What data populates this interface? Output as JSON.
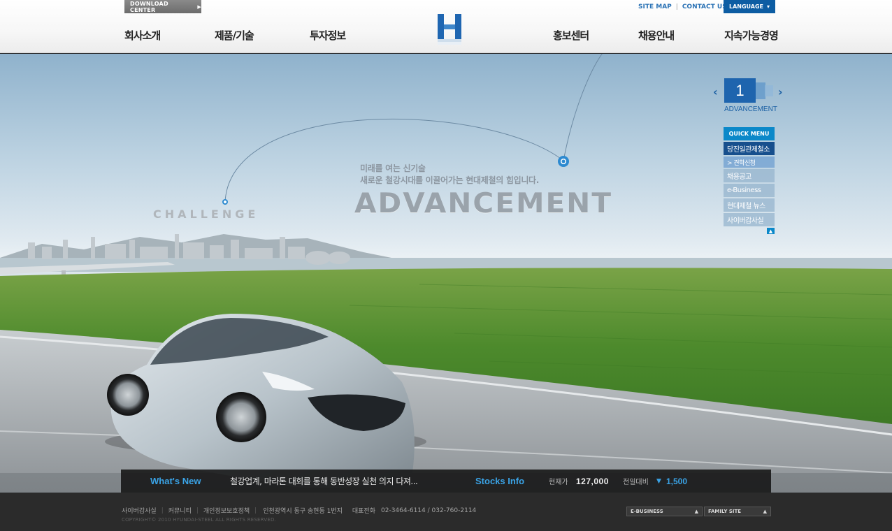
{
  "header": {
    "download_center": "DOWNLOAD CENTER",
    "site_map": "SITE MAP",
    "contact_us": "CONTACT US",
    "language": "LANGUAGE",
    "logo_letter": "H",
    "nav_left": [
      "회사소개",
      "제품/기술",
      "투자정보"
    ],
    "nav_right": [
      "홍보센터",
      "채용안내",
      "지속가능경영"
    ]
  },
  "hero": {
    "subtitle_line1": "미래를 여는 신기술",
    "subtitle_line2": "새로운 철강시대를 이끌어가는 현대제철의 힘입니다.",
    "title": "ADVANCEMENT",
    "secondary_title": "CHALLENGE",
    "slide_number": "1",
    "slide_caption": "ADVANCEMENT",
    "prev_glyph": "‹",
    "next_glyph": "›"
  },
  "quick_menu": {
    "heading": "QUICK MENU",
    "items": [
      "당진일관제철소",
      "> 견학신청",
      "채용공고",
      "e-Business",
      "현대제철 뉴스",
      "사이버감사실"
    ],
    "top_glyph": "▲"
  },
  "news": {
    "whats_new_label": "What's New",
    "whats_new_text": "철강업계, 마라톤 대회를 통해 동반성장 실천 의지 다져...",
    "stocks_label": "Stocks Info",
    "price_label": "현재가",
    "price": "127,000",
    "change_label": "전일대비",
    "change_arrow": "▼",
    "change": "1,500"
  },
  "footer": {
    "links": [
      "사이버감사실",
      "커뮤니티",
      "개인정보보호정책"
    ],
    "address": "인천광역시 동구 송현동 1번지",
    "tel_label": "대표전화",
    "tel": "02-3464-6114 / 032-760-2114",
    "copyright": "COPYRIGHT© 2010 HYUNDAI-STEEL ALL RIGHTS RESERVED.",
    "select_ebusiness": "E-BUSINESS",
    "select_family": "FAMILY SITE"
  },
  "colors": {
    "accent_blue": "#1e64ae",
    "quick_menu_blue": "#0b88c9",
    "news_label_blue": "#3aa3e6"
  }
}
